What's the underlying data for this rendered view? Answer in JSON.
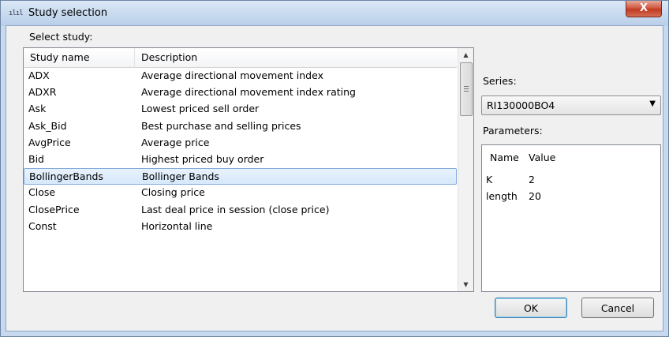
{
  "window": {
    "title": "Study selection",
    "close_glyph": "X"
  },
  "labels": {
    "select_study": "Select study:",
    "series": "Series:",
    "parameters": "Parameters:"
  },
  "studies": {
    "columns": [
      "Study name",
      "Description"
    ],
    "rows": [
      {
        "name": "ADX",
        "description": "Average directional movement index"
      },
      {
        "name": "ADXR",
        "description": "Average directional movement index rating"
      },
      {
        "name": "Ask",
        "description": "Lowest priced sell order"
      },
      {
        "name": "Ask_Bid",
        "description": "Best purchase and selling prices"
      },
      {
        "name": "AvgPrice",
        "description": "Average price"
      },
      {
        "name": "Bid",
        "description": "Highest priced buy order"
      },
      {
        "name": "BollingerBands",
        "description": "Bollinger Bands"
      },
      {
        "name": "Close",
        "description": "Closing price"
      },
      {
        "name": "ClosePrice",
        "description": "Last deal price in session (close price)"
      },
      {
        "name": "Const",
        "description": "Horizontal line"
      }
    ],
    "selected_index": 6
  },
  "series": {
    "selected": "RI130000BO4"
  },
  "parameters": {
    "columns": [
      "Name",
      "Value"
    ],
    "rows": [
      {
        "name": "K",
        "value": "2"
      },
      {
        "name": "length",
        "value": "20"
      }
    ]
  },
  "buttons": {
    "ok": "OK",
    "cancel": "Cancel"
  },
  "colors": {
    "selection": "#d6e8fb",
    "title_bar": "#c5d8ee",
    "close_button": "#c23a22"
  }
}
